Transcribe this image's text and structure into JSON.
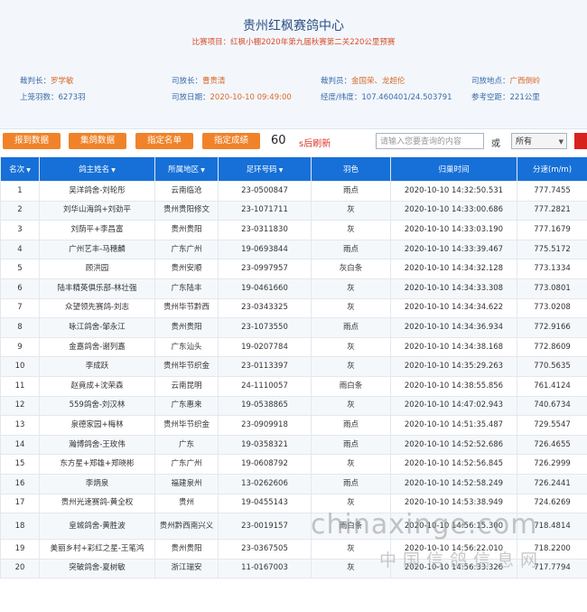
{
  "header": {
    "title": "贵州红枫赛鸽中心",
    "subtitle": "比赛项目：红枫小棚2020年第九届秋赛第二关220公里预赛",
    "info": [
      {
        "k": "裁判长：",
        "v": "罗学敏"
      },
      {
        "k": "司放长：",
        "v": "曹贵清"
      },
      {
        "k": "裁判员：",
        "v": "金国荣、龙超伦"
      },
      {
        "k": "司放地点：",
        "v": "广西倒岭"
      },
      {
        "k": "上笼羽数：",
        "v": "6273羽"
      },
      {
        "k": "司放日期：",
        "v": "2020-10-10 09:49:00"
      },
      {
        "k": "经度/纬度：",
        "v": "107.460401/24.503791"
      },
      {
        "k": "参考空距：",
        "v": "221公里"
      }
    ]
  },
  "toolbar": {
    "buttons": [
      "报到数据",
      "集鸽数据",
      "指定名单",
      "指定成绩"
    ],
    "countdown": "60",
    "refresh_label": "s后刷新",
    "search_placeholder": "请输入您要查询的内容",
    "or_label": "或",
    "select_value": "所有"
  },
  "table": {
    "columns": [
      "名次",
      "鸽主姓名",
      "所属地区",
      "足环号码",
      "羽色",
      "归巢时间",
      "分速(m/m)"
    ],
    "rows": [
      [
        "1",
        "吴洋鸽舍-刘轮彤",
        "云南临沧",
        "23-0500847",
        "雨点",
        "2020-10-10 14:32:50.531",
        "777.7455"
      ],
      [
        "2",
        "刘华山海鸽+刘劲平",
        "贵州贵阳修文",
        "23-1071711",
        "灰",
        "2020-10-10 14:33:00.686",
        "777.2821"
      ],
      [
        "3",
        "刘荫平+李昌富",
        "贵州贵阳",
        "23-0311830",
        "灰",
        "2020-10-10 14:33:03.190",
        "777.1679"
      ],
      [
        "4",
        "广州艺丰-马穗麟",
        "广东广州",
        "19-0693844",
        "雨点",
        "2020-10-10 14:33:39.467",
        "775.5172"
      ],
      [
        "5",
        "顾洪园",
        "贵州安顺",
        "23-0997957",
        "灰白条",
        "2020-10-10 14:34:32.128",
        "773.1334"
      ],
      [
        "6",
        "陆丰精英俱乐部-林壮强",
        "广东陆丰",
        "19-0461660",
        "灰",
        "2020-10-10 14:34:33.308",
        "773.0801"
      ],
      [
        "7",
        "众望领先赛鸽-刘志",
        "贵州毕节黔西",
        "23-0343325",
        "灰",
        "2020-10-10 14:34:34.622",
        "773.0208"
      ],
      [
        "8",
        "咏江鸽舍-邹永江",
        "贵州贵阳",
        "23-1073550",
        "雨点",
        "2020-10-10 14:34:36.934",
        "772.9166"
      ],
      [
        "9",
        "金嘉鸽舍-谢列嘉",
        "广东汕头",
        "19-0207784",
        "灰",
        "2020-10-10 14:34:38.168",
        "772.8609"
      ],
      [
        "10",
        "李成跃",
        "贵州毕节织金",
        "23-0113397",
        "灰",
        "2020-10-10 14:35:29.263",
        "770.5635"
      ],
      [
        "11",
        "赵竟成+沈荣森",
        "云南昆明",
        "24-1110057",
        "雨白条",
        "2020-10-10 14:38:55.856",
        "761.4124"
      ],
      [
        "12",
        "559鸽舍-刘汉林",
        "广东惠来",
        "19-0538865",
        "灰",
        "2020-10-10 14:47:02.943",
        "740.6734"
      ],
      [
        "13",
        "泉德家园+梅林",
        "贵州毕节织金",
        "23-0909918",
        "雨点",
        "2020-10-10 14:51:35.487",
        "729.5547"
      ],
      [
        "14",
        "瀚博鸽舍-王玫伟",
        "广东",
        "19-0358321",
        "雨点",
        "2020-10-10 14:52:52.686",
        "726.4655"
      ],
      [
        "15",
        "东方星+郑雄+郑晓彬",
        "广东广州",
        "19-0608792",
        "灰",
        "2020-10-10 14:52:56.845",
        "726.2999"
      ],
      [
        "16",
        "李炳泉",
        "福建泉州",
        "13-0262606",
        "雨点",
        "2020-10-10 14:52:58.249",
        "726.2441"
      ],
      [
        "17",
        "贵州光速赛鸽-黄全权",
        "贵州",
        "19-0455143",
        "灰",
        "2020-10-10 14:53:38.949",
        "724.6269"
      ],
      [
        "18",
        "皇城鸽舍-黄胜波",
        "贵州黔西南兴义",
        "23-0019157",
        "雨白条",
        "2020-10-10 14:56:15.300",
        "718.4814"
      ],
      [
        "19",
        "美丽乡村+彩红之星-王笔鸿",
        "贵州贵阳",
        "23-0367505",
        "灰",
        "2020-10-10 14:56:22.010",
        "718.2200"
      ],
      [
        "20",
        "突破鸽舍-夏树敏",
        "浙江瑞安",
        "11-0167003",
        "灰",
        "2020-10-10 14:56:33.326",
        "717.7794"
      ]
    ]
  },
  "watermark": {
    "line1": "chinaxinge.com",
    "line2": "中国信鸽信息网"
  }
}
